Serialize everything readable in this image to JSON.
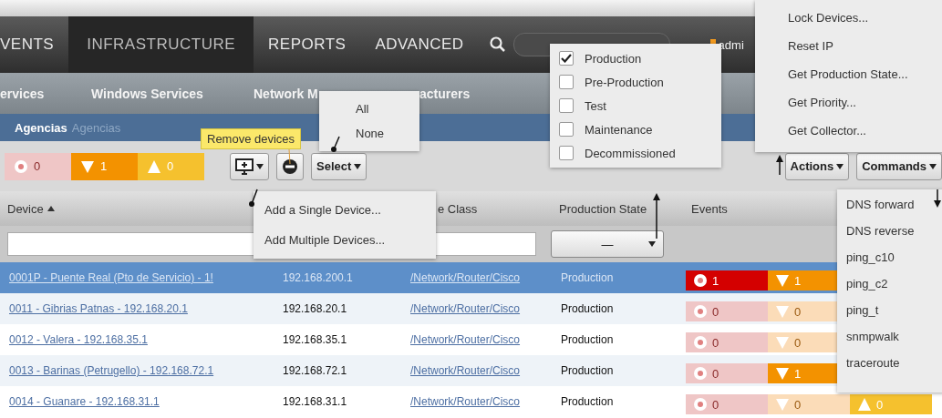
{
  "nav": {
    "tabs": [
      {
        "label": "VENTS",
        "selected": false
      },
      {
        "label": "INFRASTRUCTURE",
        "selected": true
      },
      {
        "label": "REPORTS",
        "selected": false
      },
      {
        "label": "ADVANCED",
        "selected": false
      }
    ],
    "user": "admi"
  },
  "subnav": [
    "ervices",
    "Windows Services",
    "Network M",
    "acturers"
  ],
  "breadcrumb": {
    "current": "Agencias",
    "path": "Agencias"
  },
  "summary": [
    {
      "kind": "critical",
      "count": "0",
      "dimmed": true
    },
    {
      "kind": "error",
      "count": "1",
      "dimmed": false
    },
    {
      "kind": "warning",
      "count": "0",
      "dimmed": false
    }
  ],
  "toolbar": {
    "select": "Select",
    "actions": "Actions",
    "commands": "Commands",
    "tooltip": "Remove devices"
  },
  "table": {
    "columns": [
      {
        "label": "Device",
        "sorted": true
      },
      {
        "label": "e Class",
        "sorted": false
      },
      {
        "label": "Production State",
        "sorted": false
      },
      {
        "label": "Events",
        "sorted": false
      }
    ],
    "filter": {
      "production_state": "—"
    },
    "rows": [
      {
        "device": "0001P - Puente Real (Pto de Servicio) - 1!",
        "ip": "192.168.200.1",
        "device_class": "/Network/Router/Cisco",
        "state": "Production",
        "selected": true,
        "events": [
          {
            "kind": "critical",
            "count": "1",
            "dimmed": false
          },
          {
            "kind": "error",
            "count": "1",
            "dimmed": false
          }
        ]
      },
      {
        "device": "0011 - Gibrias Patnas - 192.168.20.1",
        "ip": "192.168.20.1",
        "device_class": "/Network/Router/Cisco",
        "state": "Production",
        "selected": false,
        "events": [
          {
            "kind": "critical",
            "count": "0",
            "dimmed": true
          },
          {
            "kind": "error",
            "count": "0",
            "dimmed": true
          }
        ]
      },
      {
        "device": "0012 - Valera - 192.168.35.1",
        "ip": "192.168.35.1",
        "device_class": "/Network/Router/Cisco",
        "state": "Production",
        "selected": false,
        "events": [
          {
            "kind": "critical",
            "count": "0",
            "dimmed": true
          },
          {
            "kind": "error",
            "count": "0",
            "dimmed": true
          }
        ]
      },
      {
        "device": "0013 - Barinas (Petrugello) - 192.168.72.1",
        "ip": "192.168.72.1",
        "device_class": "/Network/Router/Cisco",
        "state": "Production",
        "selected": false,
        "events": [
          {
            "kind": "critical",
            "count": "0",
            "dimmed": true
          },
          {
            "kind": "error",
            "count": "1",
            "dimmed": false
          }
        ]
      },
      {
        "device": "0014 - Guanare - 192.168.31.1",
        "ip": "192.168.31.1",
        "device_class": "/Network/Router/Cisco",
        "state": "Production",
        "selected": false,
        "events": [
          {
            "kind": "critical",
            "count": "0",
            "dimmed": true
          },
          {
            "kind": "error",
            "count": "0",
            "dimmed": true
          },
          {
            "kind": "warning",
            "count": "0",
            "dimmed": false
          }
        ]
      }
    ]
  },
  "select_menu": [
    "All",
    "None"
  ],
  "add_menu": [
    "Add a Single Device...",
    "Add Multiple Devices..."
  ],
  "production_menu": [
    {
      "label": "Production",
      "checked": true
    },
    {
      "label": "Pre-Production",
      "checked": false
    },
    {
      "label": "Test",
      "checked": false
    },
    {
      "label": "Maintenance",
      "checked": false
    },
    {
      "label": "Decommissioned",
      "checked": false
    }
  ],
  "actions_menu": [
    "Lock Devices...",
    "Reset IP",
    "Get Production State...",
    "Get Priority...",
    "Get Collector..."
  ],
  "commands_menu": [
    "DNS forward",
    "DNS reverse",
    "ping_c10",
    "ping_c2",
    "ping_t",
    "snmpwalk",
    "traceroute"
  ]
}
